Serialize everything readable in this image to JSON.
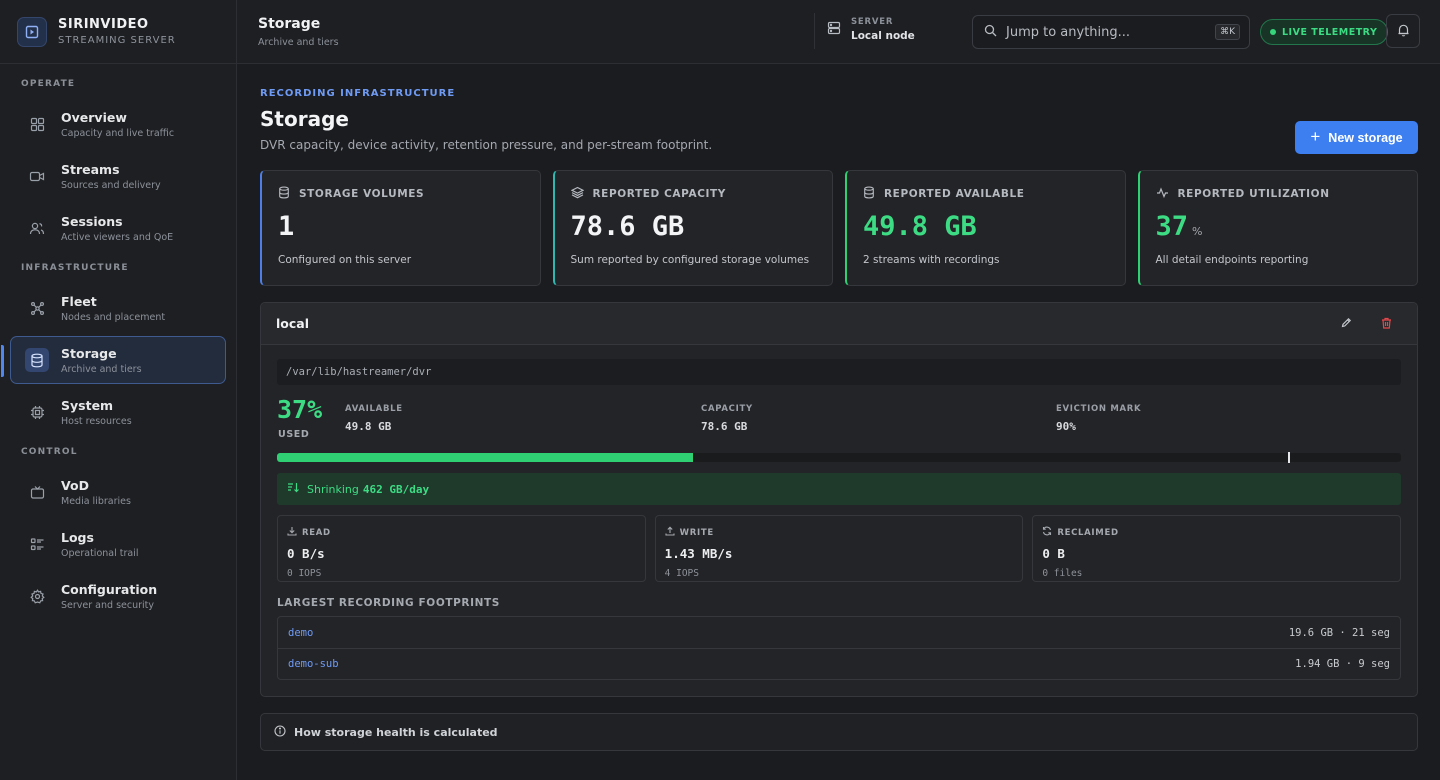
{
  "brand": {
    "name": "SIRINVIDEO",
    "subtitle": "STREAMING SERVER"
  },
  "sidebar": {
    "sections": [
      {
        "label": "OPERATE"
      },
      {
        "label": "INFRASTRUCTURE"
      },
      {
        "label": "CONTROL"
      }
    ],
    "items": [
      {
        "label": "Overview",
        "desc": "Capacity and live traffic",
        "icon": "grid-icon"
      },
      {
        "label": "Streams",
        "desc": "Sources and delivery",
        "icon": "video-icon"
      },
      {
        "label": "Sessions",
        "desc": "Active viewers and QoE",
        "icon": "users-icon"
      },
      {
        "label": "Fleet",
        "desc": "Nodes and placement",
        "icon": "nodes-icon"
      },
      {
        "label": "Storage",
        "desc": "Archive and tiers",
        "icon": "database-icon",
        "active": true
      },
      {
        "label": "System",
        "desc": "Host resources",
        "icon": "cpu-icon"
      },
      {
        "label": "VoD",
        "desc": "Media libraries",
        "icon": "tv-icon"
      },
      {
        "label": "Logs",
        "desc": "Operational trail",
        "icon": "list-icon"
      },
      {
        "label": "Configuration",
        "desc": "Server and security",
        "icon": "gear-icon"
      }
    ]
  },
  "header": {
    "title": "Storage",
    "subtitle": "Archive and tiers",
    "server_label": "SERVER",
    "server_value": "Local node",
    "search_placeholder": "Jump to anything...",
    "search_shortcut": "⌘K",
    "telemetry_label": "LIVE TELEMETRY"
  },
  "page": {
    "eyebrow": "RECORDING INFRASTRUCTURE",
    "title": "Storage",
    "description": "DVR capacity, device activity, retention pressure, and per-stream footprint.",
    "new_button": "New storage"
  },
  "stats": [
    {
      "label": "STORAGE VOLUMES",
      "value": "1",
      "unit": "",
      "note": "Configured on this server",
      "accent": "#4f7fe6"
    },
    {
      "label": "REPORTED CAPACITY",
      "value": "78.6 GB",
      "unit": "",
      "note": "Sum reported by configured storage volumes",
      "accent": "#2fb8b0"
    },
    {
      "label": "REPORTED AVAILABLE",
      "value": "49.8 GB",
      "unit": "",
      "note": "2 streams with recordings",
      "accent": "#2fcf73"
    },
    {
      "label": "REPORTED UTILIZATION",
      "value": "37",
      "unit": "%",
      "note": "All detail endpoints reporting",
      "accent": "#2fcf73"
    }
  ],
  "volume": {
    "name": "local",
    "path": "/var/lib/hastreamer/dvr",
    "used_pct": "37%",
    "used_label": "USED",
    "usage_fraction": 0.37,
    "eviction_fraction": 0.9,
    "available_label": "AVAILABLE",
    "available_value": "49.8 GB",
    "capacity_label": "CAPACITY",
    "capacity_value": "78.6 GB",
    "eviction_label": "EVICTION MARK",
    "eviction_value": "90%",
    "trend_label": "Shrinking",
    "trend_value": "462 GB/day",
    "io": [
      {
        "label": "READ",
        "value": "0 B/s",
        "sub": "0 IOPS",
        "icon": "download-icon"
      },
      {
        "label": "WRITE",
        "value": "1.43 MB/s",
        "sub": "4 IOPS",
        "icon": "upload-icon"
      },
      {
        "label": "RECLAIMED",
        "value": "0 B",
        "sub": "0 files",
        "icon": "refresh-icon"
      }
    ],
    "footprints_title": "LARGEST RECORDING FOOTPRINTS",
    "footprints": [
      {
        "name": "demo",
        "size": "19.6 GB · 21 seg"
      },
      {
        "name": "demo-sub",
        "size": "1.94 GB · 9 seg"
      }
    ]
  },
  "health_label": "How storage health is calculated",
  "colors": {
    "accent": "#3d7ff0",
    "success": "#3ddc84",
    "danger": "#e5484d"
  }
}
